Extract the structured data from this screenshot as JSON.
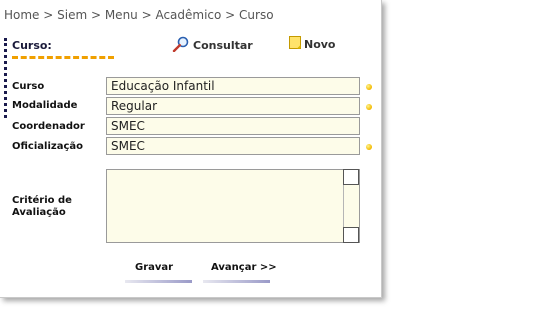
{
  "breadcrumb": "Home > Siem > Menu > Acadêmico > Curso",
  "section": {
    "title": "Curso:"
  },
  "toolbar": {
    "consultar_label": "Consultar",
    "novo_label": "Novo"
  },
  "form": {
    "curso": {
      "label": "Curso",
      "value": "Educação Infantil",
      "required": true
    },
    "modalidade": {
      "label": "Modalidade",
      "value": "Regular",
      "required": true
    },
    "coordenador": {
      "label": "Coordenador",
      "value": "SMEC",
      "required": false
    },
    "oficializacao": {
      "label": "Oficialização",
      "value": "SMEC",
      "required": true
    },
    "criterio": {
      "label": "Critério de Avaliação",
      "value": ""
    }
  },
  "actions": {
    "gravar_label": "Gravar",
    "avancar_label": "Avançar >>"
  },
  "colors": {
    "accent": "#f0a000",
    "field_bg": "#fdfce9",
    "required_dot": "#f2b800",
    "action_bar": "#9a9ac8"
  },
  "icons": {
    "consultar": "magnifier-icon",
    "novo": "note-icon"
  }
}
